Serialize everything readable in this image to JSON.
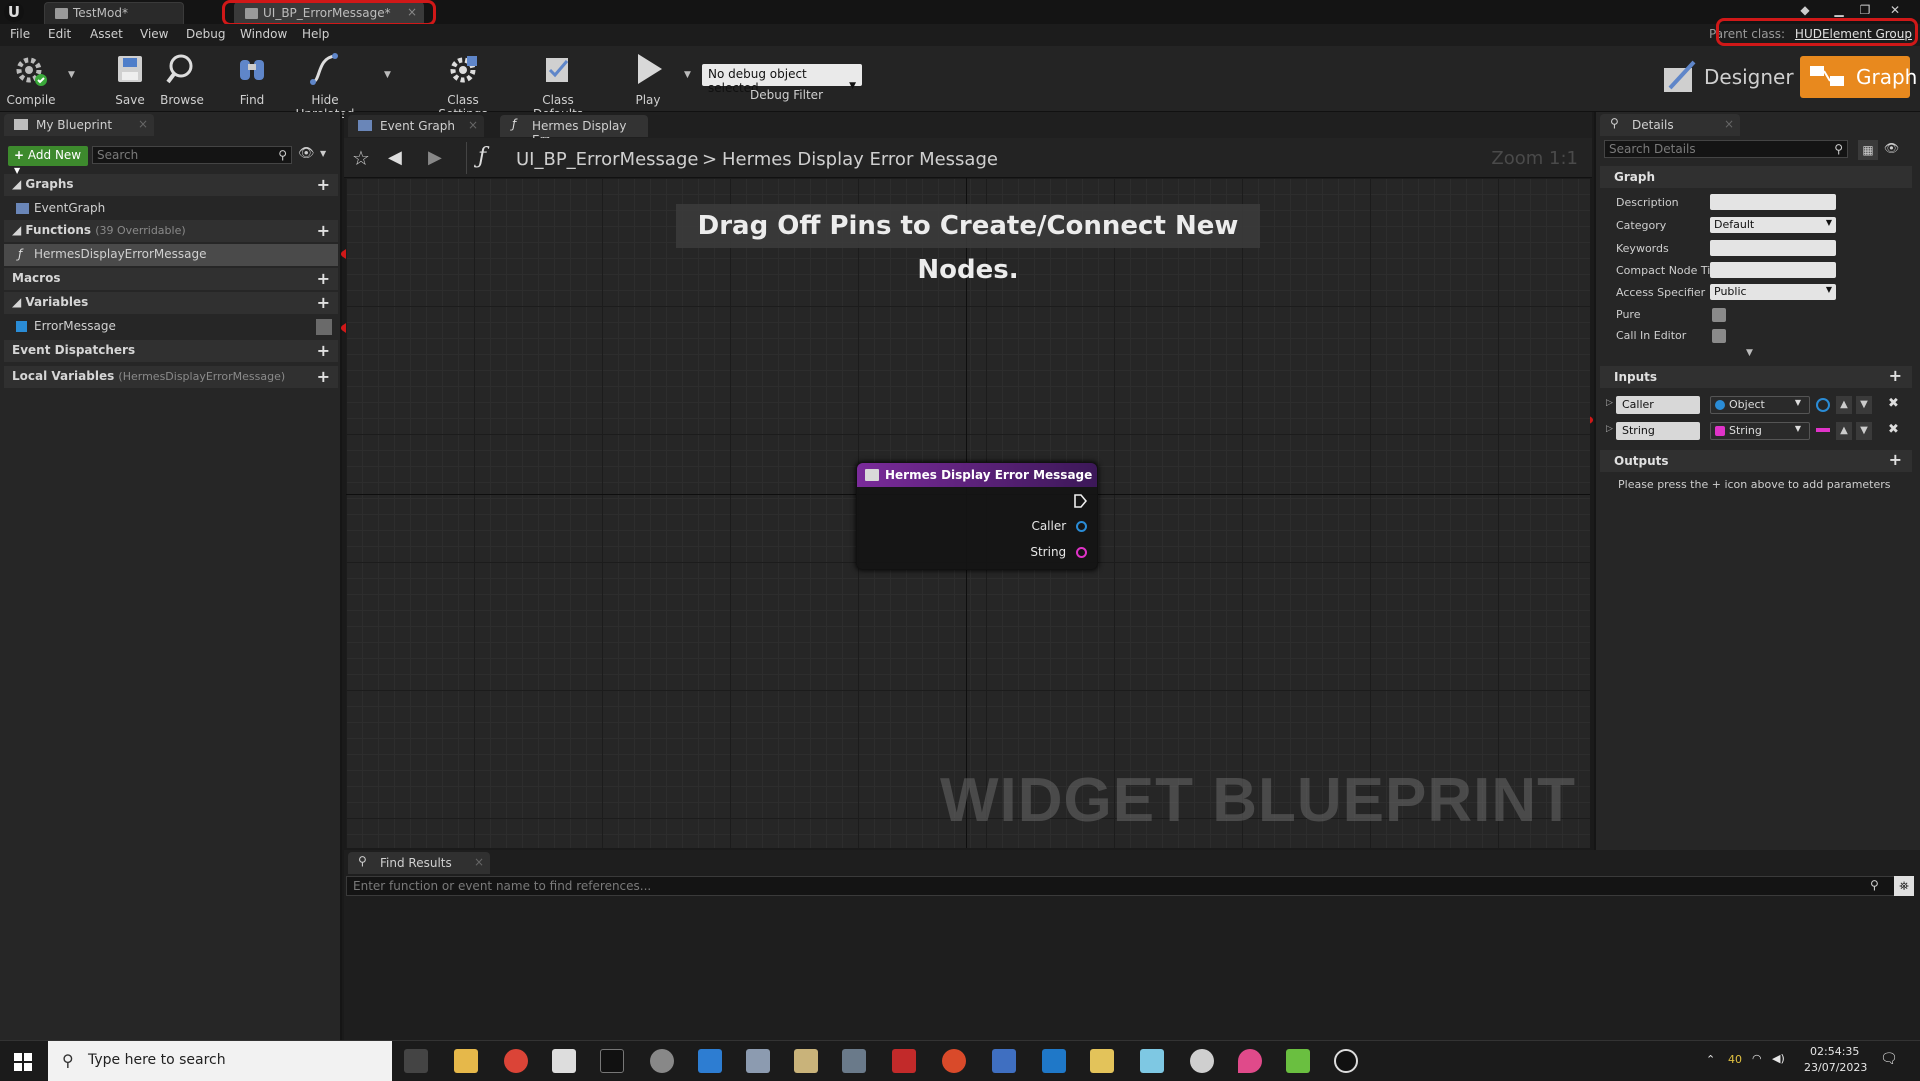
{
  "titlebar": {
    "tabs": [
      {
        "label": "TestMod*"
      },
      {
        "label": "UI_BP_ErrorMessage*"
      }
    ]
  },
  "menubar": {
    "items": [
      "File",
      "Edit",
      "Asset",
      "View",
      "Debug",
      "Window",
      "Help"
    ],
    "parent_class_label": "Parent class:",
    "parent_class_value": "HUDElement Group"
  },
  "toolbar": {
    "compile": "Compile",
    "save": "Save",
    "browse": "Browse",
    "find": "Find",
    "hide_unrelated": "Hide Unrelated",
    "class_settings": "Class Settings",
    "class_defaults": "Class Defaults",
    "play": "Play",
    "debug_object": "No debug object selected",
    "debug_filter": "Debug Filter",
    "designer": "Designer",
    "graph": "Graph"
  },
  "my_blueprint": {
    "tab": "My Blueprint",
    "add_new": "Add New",
    "search_placeholder": "Search",
    "graphs": "Graphs",
    "event_graph": "EventGraph",
    "functions": "Functions",
    "functions_note": "(39 Overridable)",
    "function_item": "HermesDisplayErrorMessage",
    "macros": "Macros",
    "variables": "Variables",
    "variable_item": "ErrorMessage",
    "event_dispatchers": "Event Dispatchers",
    "local_variables": "Local Variables",
    "local_variables_note": "(HermesDisplayErrorMessage)"
  },
  "graph": {
    "tabs": [
      {
        "label": "Event Graph"
      },
      {
        "label": "Hermes Display Err"
      }
    ],
    "breadcrumb_root": "UI_BP_ErrorMessage",
    "breadcrumb_sep": ">",
    "breadcrumb_leaf": "Hermes Display Error Message",
    "zoom": "Zoom 1:1",
    "hint": "Drag Off Pins to Create/Connect New Nodes.",
    "watermark": "WIDGET BLUEPRINT",
    "node_title": "Hermes Display Error Message",
    "pin_caller": "Caller",
    "pin_string": "String"
  },
  "find_results": {
    "tab": "Find Results",
    "placeholder": "Enter function or event name to find references..."
  },
  "details": {
    "tab": "Details",
    "search_placeholder": "Search Details",
    "graph_section": "Graph",
    "description": "Description",
    "category": "Category",
    "category_value": "Default",
    "keywords": "Keywords",
    "compact_node_title": "Compact Node Ti",
    "access_specifier": "Access Specifier",
    "access_value": "Public",
    "pure": "Pure",
    "call_in_editor": "Call In Editor",
    "inputs": "Inputs",
    "params": [
      {
        "name": "Caller",
        "type": "Object",
        "color": "#2a8cd6"
      },
      {
        "name": "String",
        "type": "String",
        "color": "#e033c8"
      }
    ],
    "outputs": "Outputs",
    "outputs_hint": "Please press the + icon above to add parameters"
  },
  "taskbar": {
    "search_placeholder": "Type here to search",
    "time": "02:54:35",
    "date": "23/07/2023",
    "temp": "40"
  },
  "colors": {
    "accent_graph": "#e8891e",
    "annotation_red": "#d01818",
    "object_pin": "#2a8cd6",
    "string_pin": "#e033c8",
    "node_header": "#7a2b9a"
  }
}
